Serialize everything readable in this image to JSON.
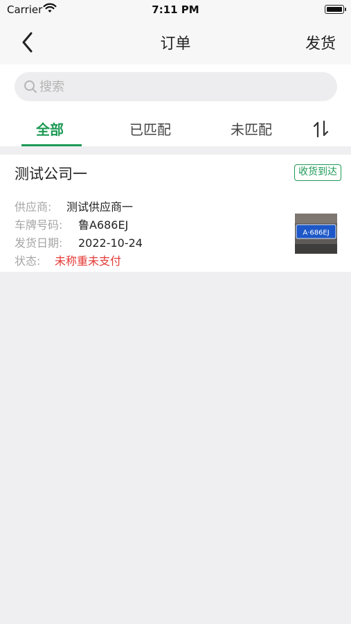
{
  "status_bar": {
    "carrier": "Carrier",
    "time": "7:11 PM"
  },
  "nav": {
    "title": "订单",
    "action": "发货"
  },
  "search": {
    "placeholder": "搜索",
    "value": ""
  },
  "tabs": [
    {
      "label": "全部",
      "active": true
    },
    {
      "label": "已匹配",
      "active": false
    },
    {
      "label": "未匹配",
      "active": false
    }
  ],
  "orders": [
    {
      "company": "测试公司一",
      "status": "收货到达",
      "supplier_label": "供应商:",
      "supplier": "测试供应商一",
      "plate_label": "车牌号码:",
      "plate": "鲁A686EJ",
      "date_label": "发货日期:",
      "date": "2022-10-24",
      "state_label": "状态:",
      "state": "未称重未支付",
      "thumbnail_text": "A·686EJ"
    }
  ],
  "colors": {
    "accent": "#1d9a55",
    "alert": "#e53935",
    "background": "#efeff1"
  }
}
